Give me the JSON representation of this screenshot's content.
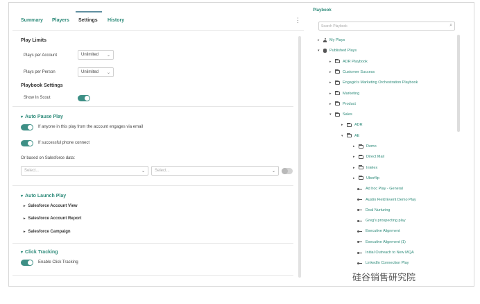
{
  "tabs": {
    "summary": "Summary",
    "players": "Players",
    "settings": "Settings",
    "history": "History"
  },
  "play_limits": {
    "heading": "Play Limits",
    "per_account_label": "Plays per Account",
    "per_account_value": "Unlimited",
    "per_person_label": "Plays per Person",
    "per_person_value": "Unlimited"
  },
  "playbook_settings": {
    "heading": "Playbook Settings",
    "show_in_scout": "Show In Scout"
  },
  "auto_pause": {
    "heading": "Auto Pause Play",
    "option_email": "If anyone in this play from the account engages via email",
    "option_phone": "If successful phone connect",
    "salesforce_label": "Or based on Salesforce data:",
    "select1_placeholder": "Select...",
    "select2_placeholder": "Select..."
  },
  "auto_launch": {
    "heading": "Auto Launch Play",
    "items": [
      "Salesforce Account View",
      "Salesforce Account Report",
      "Salesforce Campaign"
    ]
  },
  "click_tracking": {
    "heading": "Click Tracking",
    "enable": "Enable Click Tracking"
  },
  "playbook": {
    "title": "Playbook",
    "search_placeholder": "Search Playbook",
    "tree": [
      {
        "label": "My Plays",
        "icon": "person-icon",
        "caret": "▸"
      },
      {
        "label": "Published Plays",
        "icon": "database-icon",
        "caret": "▾"
      },
      {
        "label": "ADR Playbook",
        "icon": "folder-icon",
        "caret": "▸"
      },
      {
        "label": "Customer Success",
        "icon": "folder-icon",
        "caret": "▸"
      },
      {
        "label": "Engagio's Marketing Orchestration Playbook",
        "icon": "folder-icon",
        "caret": "▸"
      },
      {
        "label": "Marketing",
        "icon": "folder-icon",
        "caret": "▸"
      },
      {
        "label": "Product",
        "icon": "folder-icon",
        "caret": "▸"
      },
      {
        "label": "Sales",
        "icon": "folder-icon",
        "caret": "▾"
      },
      {
        "label": "ADR",
        "icon": "folder-icon",
        "caret": "▸"
      },
      {
        "label": "AE",
        "icon": "folder-icon",
        "caret": "▾"
      },
      {
        "label": "Demo",
        "icon": "folder-icon",
        "caret": "▸"
      },
      {
        "label": "Direct Mail",
        "icon": "folder-icon",
        "caret": "▸"
      },
      {
        "label": "Intelex",
        "icon": "folder-icon",
        "caret": "▸"
      },
      {
        "label": "Uberflip",
        "icon": "folder-icon",
        "caret": "▸"
      },
      {
        "label": "Ad hoc Play - General",
        "icon": "play-icon",
        "caret": ""
      },
      {
        "label": "Austin Field Event Demo Play",
        "icon": "play-icon",
        "caret": ""
      },
      {
        "label": "Deal Nurturing",
        "icon": "play-icon",
        "caret": ""
      },
      {
        "label": "Greg's prospecting play",
        "icon": "play-icon",
        "caret": ""
      },
      {
        "label": "Executive Alignment",
        "icon": "play-icon",
        "caret": ""
      },
      {
        "label": "Executive Alignment (1)",
        "icon": "play-icon",
        "caret": ""
      },
      {
        "label": "Initial Outreach to New MQA",
        "icon": "play-icon",
        "caret": ""
      },
      {
        "label": "LinkedIn Connection Play",
        "icon": "play-icon",
        "caret": ""
      }
    ]
  },
  "watermark": "硅谷销售研究院"
}
